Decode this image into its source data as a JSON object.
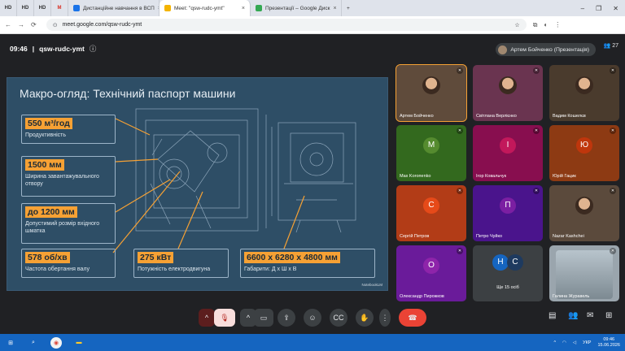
{
  "tabs": [
    {
      "label": "HD",
      "type": "small"
    },
    {
      "label": "HD",
      "type": "small"
    },
    {
      "label": "HD",
      "type": "small"
    },
    {
      "label": "M",
      "type": "small"
    },
    {
      "label": "Дистанційне навчання в ВСП",
      "color": "#1a73e8"
    },
    {
      "label": "Meet: \"qsw-rudc-ymt\"",
      "color": "#f4b400",
      "active": true
    },
    {
      "label": "Презентації – Google Диск",
      "color": "#34a853"
    }
  ],
  "address": {
    "url": "meet.google.com/qsw-rudc-ymt"
  },
  "meeting": {
    "time": "09:46",
    "code": "qsw-rudc-ymt",
    "presenter": "Артем Бойченко (Презентація)",
    "participants": "27"
  },
  "slide": {
    "title": "Макро-огляд: Технічний паспорт машини",
    "specs": [
      {
        "value": "550 м³/год",
        "label": "Продуктивність"
      },
      {
        "value": "1500 мм",
        "label": "Ширина завантажувального отвору"
      },
      {
        "value": "до 1200 мм",
        "label": "Допустимий розмір вхідного шматка"
      },
      {
        "value": "578 об/хв",
        "label": "Частота обертання валу"
      },
      {
        "value": "275 кВт",
        "label": "Потужність електродвигуна"
      },
      {
        "value": "6600 х 6280 х 4800 мм",
        "label": "Габарити: Д х Ш х В"
      }
    ],
    "watermark": "NotebookLM"
  },
  "participants": [
    {
      "name": "Артем Бойченко",
      "type": "face",
      "bg": "#5f4b3b",
      "active": true
    },
    {
      "name": "Світлана Верлієнко",
      "type": "face",
      "bg": "#6a3450"
    },
    {
      "name": "Вадим Кошелєв",
      "type": "face",
      "bg": "#4a3b2d"
    },
    {
      "name": "Max Koroпenko",
      "initial": "M",
      "bg": "#33691e",
      "color": "#558b2f"
    },
    {
      "name": "Ігор Ковальчук",
      "initial": "І",
      "bg": "#880e4f",
      "color": "#c2185b"
    },
    {
      "name": "Юрій Гацик",
      "initial": "Ю",
      "bg": "#8d3a13",
      "color": "#bf360c"
    },
    {
      "name": "Сергій Петров",
      "initial": "С",
      "bg": "#b23c17",
      "color": "#e64a19"
    },
    {
      "name": "Петро Чуйко",
      "initial": "П",
      "bg": "#4a148c",
      "color": "#7b1fa2"
    },
    {
      "name": "Nazar Kashchei",
      "type": "face",
      "bg": "#5b4a3c"
    },
    {
      "name": "Олександр Пирожков",
      "initial": "О",
      "bg": "#6a1b9a",
      "color": "#8e24aa"
    },
    {
      "name": "Ще 15 осіб",
      "type": "more",
      "bg": "#3c4043"
    },
    {
      "name": "Галина Журавель",
      "type": "face",
      "bg": "#9aa5ad"
    }
  ],
  "more_initials": [
    "Н",
    "С"
  ],
  "taskbar": {
    "lang": "УКР",
    "time": "09:46",
    "date": "15.06.2026"
  },
  "colors": {
    "accent": "#f6a134",
    "slide_bg": "#2e4e66",
    "end_call": "#ea4335"
  }
}
